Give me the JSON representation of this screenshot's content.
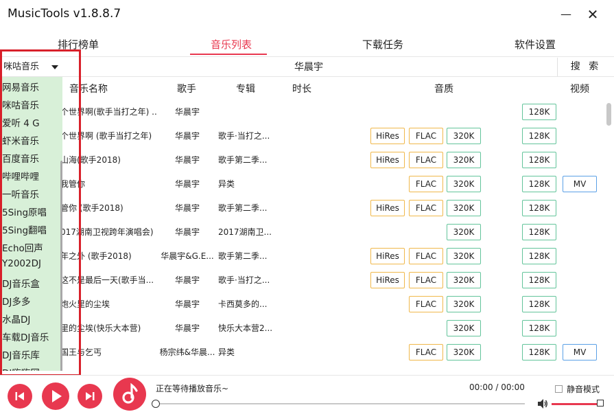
{
  "app": {
    "title": "MusicTools v1.8.8.7",
    "minimize_glyph": "—",
    "close_glyph": "✕"
  },
  "tabs": [
    "排行榜单",
    "音乐列表",
    "下载任务",
    "软件设置"
  ],
  "active_tab": "音乐列表",
  "search": {
    "source": "咪咕音乐",
    "query": "华晨宇",
    "button": "搜 索"
  },
  "columns": {
    "name": "音乐名称",
    "singer": "歌手",
    "album": "专辑",
    "duration": "时长",
    "quality": "音质",
    "video": "视频"
  },
  "rows": [
    {
      "name": "个世界啊(歌手当打之年) ...",
      "singer": "华晨宇",
      "album": "",
      "hires": "",
      "flac": "",
      "q320": "",
      "q128": "128K",
      "mv": ""
    },
    {
      "name": "个世界啊 (歌手当打之年)",
      "singer": "华晨宇",
      "album": "歌手·当打之...",
      "hires": "HiRes",
      "flac": "FLAC",
      "q320": "320K",
      "q128": "128K",
      "mv": ""
    },
    {
      "name": "山海(歌手2018)",
      "singer": "华晨宇",
      "album": "歌手第二季...",
      "hires": "HiRes",
      "flac": "FLAC",
      "q320": "320K",
      "q128": "128K",
      "mv": ""
    },
    {
      "name": "我管你",
      "singer": "华晨宇",
      "album": "异类",
      "hires": "",
      "flac": "FLAC",
      "q320": "320K",
      "q128": "128K",
      "mv": "MV"
    },
    {
      "name": "管你 (歌手2018)",
      "singer": "华晨宇",
      "album": "歌手第二季...",
      "hires": "HiRes",
      "flac": "FLAC",
      "q320": "320K",
      "q128": "128K",
      "mv": ""
    },
    {
      "name": "017湖南卫视跨年演唱会)",
      "singer": "华晨宇",
      "album": "2017湖南卫...",
      "hires": "",
      "flac": "",
      "q320": "320K",
      "q128": "128K",
      "mv": ""
    },
    {
      "name": "年之外 (歌手2018)",
      "singer": "华晨宇&G.E...",
      "album": "歌手第二季...",
      "hires": "HiRes",
      "flac": "FLAC",
      "q320": "320K",
      "q128": "128K",
      "mv": ""
    },
    {
      "name": "这不是最后一天(歌手当...",
      "singer": "华晨宇",
      "album": "歌手·当打之...",
      "hires": "HiRes",
      "flac": "FLAC",
      "q320": "320K",
      "q128": "128K",
      "mv": ""
    },
    {
      "name": "炮火里的尘埃",
      "singer": "华晨宇",
      "album": "卡西莫多的...",
      "hires": "",
      "flac": "FLAC",
      "q320": "320K",
      "q128": "128K",
      "mv": ""
    },
    {
      "name": "里的尘埃(快乐大本营)",
      "singer": "华晨宇",
      "album": "快乐大本营2...",
      "hires": "",
      "flac": "",
      "q320": "320K",
      "q128": "128K",
      "mv": ""
    },
    {
      "name": "国王与乞丐",
      "singer": "杨宗纬&华晨...",
      "album": "异类",
      "hires": "",
      "flac": "FLAC",
      "q320": "320K",
      "q128": "128K",
      "mv": "MV"
    }
  ],
  "sources": [
    "网易音乐",
    "咪咕音乐",
    "爱听 4 G",
    "虾米音乐",
    "百度音乐",
    "哔哩哔哩",
    "一听音乐",
    "5Sing原唱",
    "5Sing翻唱",
    "Echo回声",
    "Y2002DJ",
    "DJ音乐盒",
    "DJ多多",
    "水晶DJ",
    "车载DJ音乐",
    "DJ音乐库",
    "DJ嗨嗨网"
  ],
  "player": {
    "status": "正在等待播放音乐~",
    "time": "00:00 / 00:00",
    "mute_label": "静音模式",
    "volume_fraction": 1.0,
    "progress_fraction": 0.0
  },
  "colors": {
    "accent": "#e8384f",
    "hires_border": "#f0b84a",
    "ok_border": "#62c49a",
    "mv_border": "#5aa0e6",
    "dropdown_bg": "#d8f0d8",
    "highlight": "#d8202a"
  },
  "icons": {
    "prev": "skip-previous-icon",
    "play": "play-icon",
    "next": "skip-next-icon",
    "logo": "music-note-icon",
    "volume": "volume-icon"
  }
}
